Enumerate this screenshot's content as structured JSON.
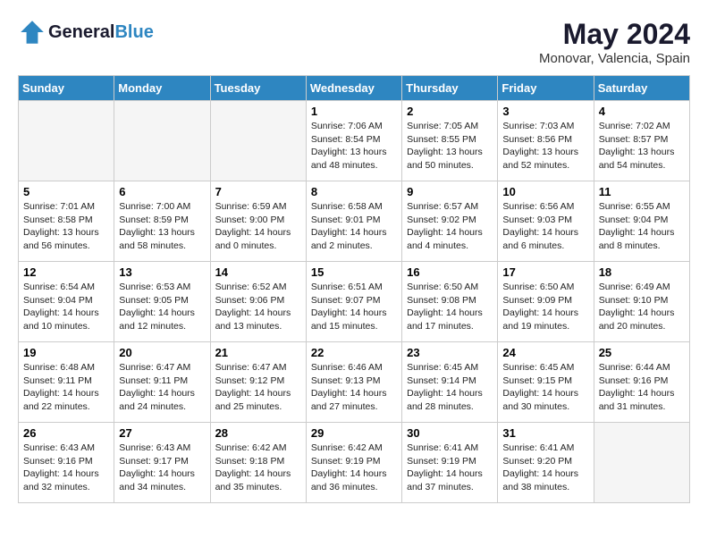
{
  "header": {
    "logo_line1": "General",
    "logo_line2": "Blue",
    "month_year": "May 2024",
    "location": "Monovar, Valencia, Spain"
  },
  "weekdays": [
    "Sunday",
    "Monday",
    "Tuesday",
    "Wednesday",
    "Thursday",
    "Friday",
    "Saturday"
  ],
  "weeks": [
    [
      {
        "day": "",
        "empty": true
      },
      {
        "day": "",
        "empty": true
      },
      {
        "day": "",
        "empty": true
      },
      {
        "day": "1",
        "sunrise": "Sunrise: 7:06 AM",
        "sunset": "Sunset: 8:54 PM",
        "daylight": "Daylight: 13 hours and 48 minutes."
      },
      {
        "day": "2",
        "sunrise": "Sunrise: 7:05 AM",
        "sunset": "Sunset: 8:55 PM",
        "daylight": "Daylight: 13 hours and 50 minutes."
      },
      {
        "day": "3",
        "sunrise": "Sunrise: 7:03 AM",
        "sunset": "Sunset: 8:56 PM",
        "daylight": "Daylight: 13 hours and 52 minutes."
      },
      {
        "day": "4",
        "sunrise": "Sunrise: 7:02 AM",
        "sunset": "Sunset: 8:57 PM",
        "daylight": "Daylight: 13 hours and 54 minutes."
      }
    ],
    [
      {
        "day": "5",
        "sunrise": "Sunrise: 7:01 AM",
        "sunset": "Sunset: 8:58 PM",
        "daylight": "Daylight: 13 hours and 56 minutes."
      },
      {
        "day": "6",
        "sunrise": "Sunrise: 7:00 AM",
        "sunset": "Sunset: 8:59 PM",
        "daylight": "Daylight: 13 hours and 58 minutes."
      },
      {
        "day": "7",
        "sunrise": "Sunrise: 6:59 AM",
        "sunset": "Sunset: 9:00 PM",
        "daylight": "Daylight: 14 hours and 0 minutes."
      },
      {
        "day": "8",
        "sunrise": "Sunrise: 6:58 AM",
        "sunset": "Sunset: 9:01 PM",
        "daylight": "Daylight: 14 hours and 2 minutes."
      },
      {
        "day": "9",
        "sunrise": "Sunrise: 6:57 AM",
        "sunset": "Sunset: 9:02 PM",
        "daylight": "Daylight: 14 hours and 4 minutes."
      },
      {
        "day": "10",
        "sunrise": "Sunrise: 6:56 AM",
        "sunset": "Sunset: 9:03 PM",
        "daylight": "Daylight: 14 hours and 6 minutes."
      },
      {
        "day": "11",
        "sunrise": "Sunrise: 6:55 AM",
        "sunset": "Sunset: 9:04 PM",
        "daylight": "Daylight: 14 hours and 8 minutes."
      }
    ],
    [
      {
        "day": "12",
        "sunrise": "Sunrise: 6:54 AM",
        "sunset": "Sunset: 9:04 PM",
        "daylight": "Daylight: 14 hours and 10 minutes."
      },
      {
        "day": "13",
        "sunrise": "Sunrise: 6:53 AM",
        "sunset": "Sunset: 9:05 PM",
        "daylight": "Daylight: 14 hours and 12 minutes."
      },
      {
        "day": "14",
        "sunrise": "Sunrise: 6:52 AM",
        "sunset": "Sunset: 9:06 PM",
        "daylight": "Daylight: 14 hours and 13 minutes."
      },
      {
        "day": "15",
        "sunrise": "Sunrise: 6:51 AM",
        "sunset": "Sunset: 9:07 PM",
        "daylight": "Daylight: 14 hours and 15 minutes."
      },
      {
        "day": "16",
        "sunrise": "Sunrise: 6:50 AM",
        "sunset": "Sunset: 9:08 PM",
        "daylight": "Daylight: 14 hours and 17 minutes."
      },
      {
        "day": "17",
        "sunrise": "Sunrise: 6:50 AM",
        "sunset": "Sunset: 9:09 PM",
        "daylight": "Daylight: 14 hours and 19 minutes."
      },
      {
        "day": "18",
        "sunrise": "Sunrise: 6:49 AM",
        "sunset": "Sunset: 9:10 PM",
        "daylight": "Daylight: 14 hours and 20 minutes."
      }
    ],
    [
      {
        "day": "19",
        "sunrise": "Sunrise: 6:48 AM",
        "sunset": "Sunset: 9:11 PM",
        "daylight": "Daylight: 14 hours and 22 minutes."
      },
      {
        "day": "20",
        "sunrise": "Sunrise: 6:47 AM",
        "sunset": "Sunset: 9:11 PM",
        "daylight": "Daylight: 14 hours and 24 minutes."
      },
      {
        "day": "21",
        "sunrise": "Sunrise: 6:47 AM",
        "sunset": "Sunset: 9:12 PM",
        "daylight": "Daylight: 14 hours and 25 minutes."
      },
      {
        "day": "22",
        "sunrise": "Sunrise: 6:46 AM",
        "sunset": "Sunset: 9:13 PM",
        "daylight": "Daylight: 14 hours and 27 minutes."
      },
      {
        "day": "23",
        "sunrise": "Sunrise: 6:45 AM",
        "sunset": "Sunset: 9:14 PM",
        "daylight": "Daylight: 14 hours and 28 minutes."
      },
      {
        "day": "24",
        "sunrise": "Sunrise: 6:45 AM",
        "sunset": "Sunset: 9:15 PM",
        "daylight": "Daylight: 14 hours and 30 minutes."
      },
      {
        "day": "25",
        "sunrise": "Sunrise: 6:44 AM",
        "sunset": "Sunset: 9:16 PM",
        "daylight": "Daylight: 14 hours and 31 minutes."
      }
    ],
    [
      {
        "day": "26",
        "sunrise": "Sunrise: 6:43 AM",
        "sunset": "Sunset: 9:16 PM",
        "daylight": "Daylight: 14 hours and 32 minutes."
      },
      {
        "day": "27",
        "sunrise": "Sunrise: 6:43 AM",
        "sunset": "Sunset: 9:17 PM",
        "daylight": "Daylight: 14 hours and 34 minutes."
      },
      {
        "day": "28",
        "sunrise": "Sunrise: 6:42 AM",
        "sunset": "Sunset: 9:18 PM",
        "daylight": "Daylight: 14 hours and 35 minutes."
      },
      {
        "day": "29",
        "sunrise": "Sunrise: 6:42 AM",
        "sunset": "Sunset: 9:19 PM",
        "daylight": "Daylight: 14 hours and 36 minutes."
      },
      {
        "day": "30",
        "sunrise": "Sunrise: 6:41 AM",
        "sunset": "Sunset: 9:19 PM",
        "daylight": "Daylight: 14 hours and 37 minutes."
      },
      {
        "day": "31",
        "sunrise": "Sunrise: 6:41 AM",
        "sunset": "Sunset: 9:20 PM",
        "daylight": "Daylight: 14 hours and 38 minutes."
      },
      {
        "day": "",
        "empty": true
      }
    ]
  ]
}
